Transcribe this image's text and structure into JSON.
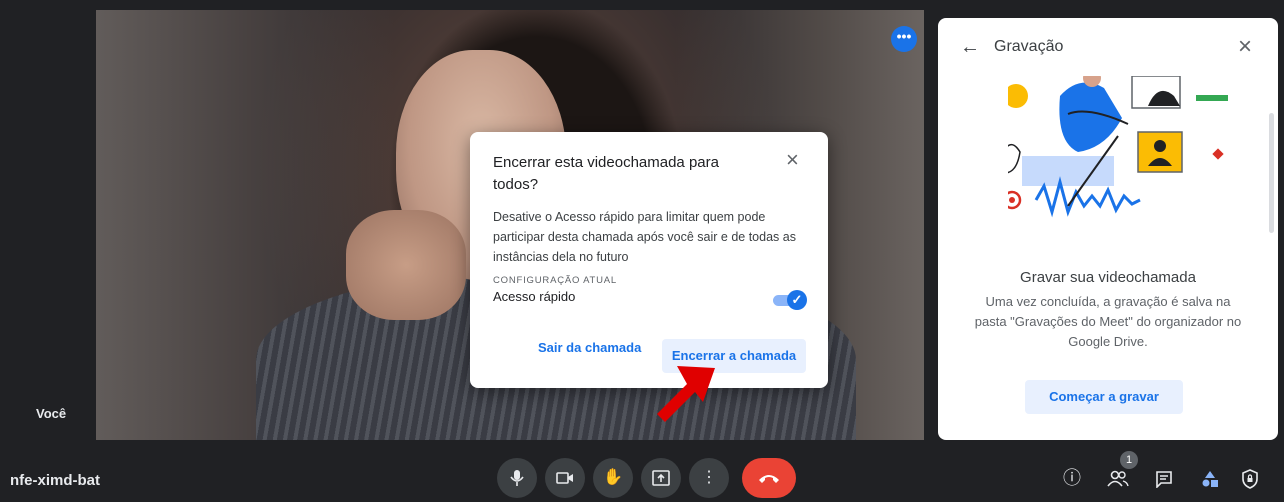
{
  "meeting": {
    "code": "nfe-ximd-bat",
    "self_label": "Você"
  },
  "panel": {
    "title": "Gravação",
    "heading": "Gravar sua videochamada",
    "description": "Uma vez concluída, a gravação é salva na pasta \"Gravações do Meet\" do organizador no Google Drive.",
    "record_button": "Começar a gravar"
  },
  "dialog": {
    "title": "Encerrar esta videochamada para todos?",
    "body": "Desative o Acesso rápido para limitar quem pode participar desta chamada após você sair e de todas as instâncias dela no futuro",
    "caption": "CONFIGURAÇÃO ATUAL",
    "setting_label": "Acesso rápido",
    "toggle_on": true,
    "leave_button": "Sair da chamada",
    "end_button": "Encerrar a chamada"
  },
  "toolbar": {
    "participants_count": "1",
    "icons": [
      "microphone-icon",
      "camera-icon",
      "raise-hand-icon",
      "present-icon",
      "more-options-icon",
      "hang-up-icon",
      "info-icon",
      "people-icon",
      "chat-icon",
      "activities-icon",
      "host-controls-icon"
    ]
  },
  "colors": {
    "accent": "#1a73e8",
    "end_call": "#ea4335",
    "arrow": "#e00000",
    "background": "#202124"
  }
}
